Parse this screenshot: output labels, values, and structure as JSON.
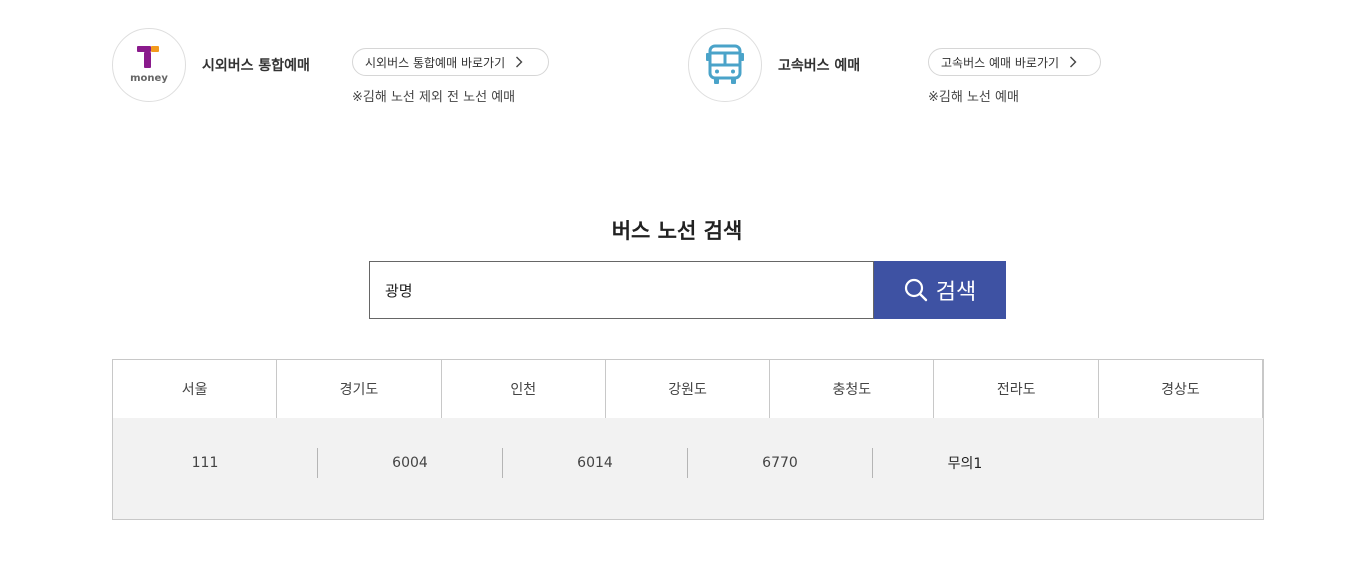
{
  "booking_cards": [
    {
      "title": "시외버스 통합예매",
      "link_label": "시외버스 통합예매 바로가기",
      "note": "※김해 노선 제외 전 노선 예매"
    },
    {
      "title": "고속버스 예매",
      "link_label": "고속버스 예매 바로가기",
      "note": "※김해 노선 예매"
    }
  ],
  "search": {
    "title": "버스 노선 검색",
    "input_value": "광명",
    "button_label": "검색"
  },
  "regions": [
    "서울",
    "경기도",
    "인천",
    "강원도",
    "충청도",
    "전라도",
    "경상도"
  ],
  "routes": [
    "111",
    "6004",
    "6014",
    "6770",
    "무의1"
  ],
  "icons": {
    "tmoney_logo": "tmoney-logo",
    "bus_icon": "bus-icon",
    "chevron": "chevron-right-icon",
    "search": "search-icon"
  },
  "colors": {
    "accent": "#3e52a3",
    "bus_icon": "#4aa3c9",
    "tmoney_purple": "#8a1a8c",
    "tmoney_orange": "#f39a1e",
    "panel_bg": "#f2f2f2"
  },
  "tmoney_logo_text": "money"
}
